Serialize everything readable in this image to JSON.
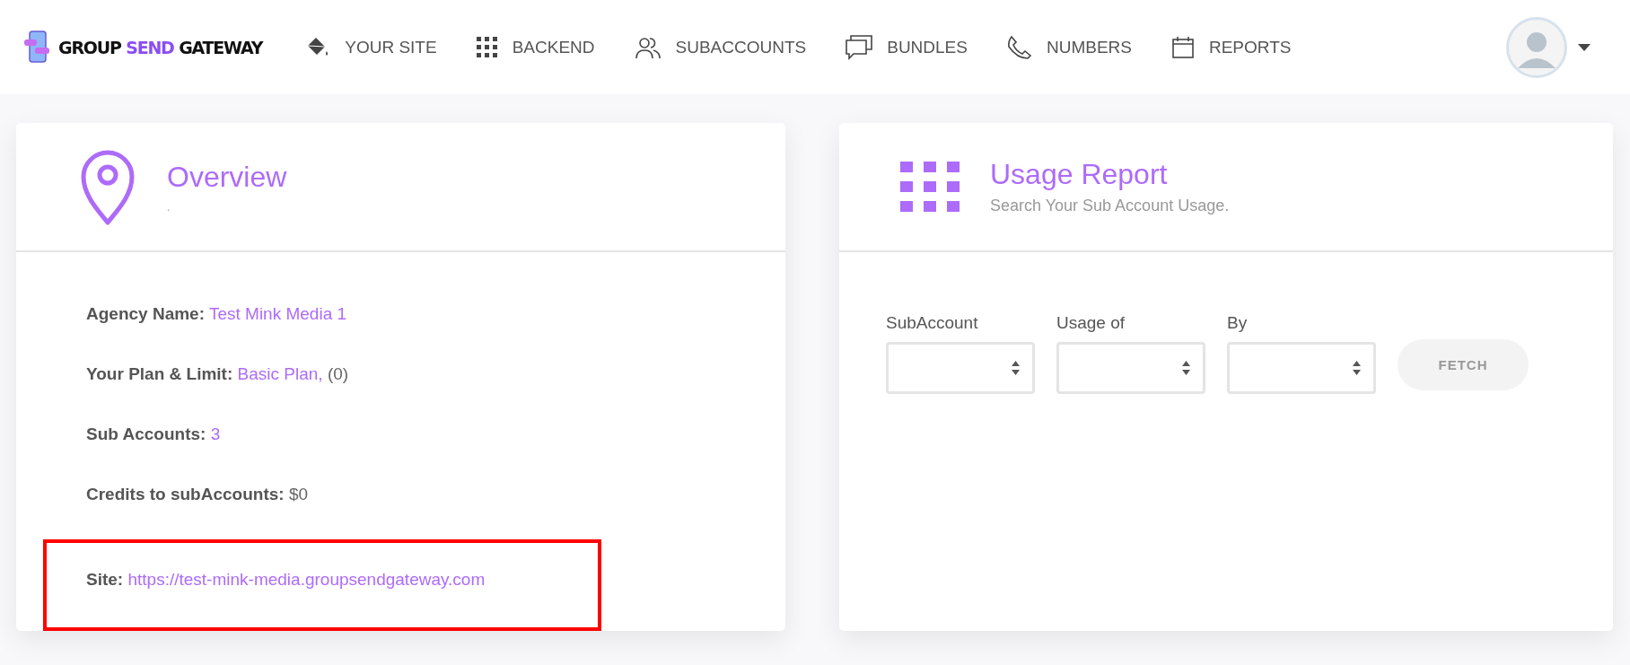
{
  "header": {
    "logo_words": [
      {
        "text": "GROUP",
        "highlight": false
      },
      {
        "text": "SEND",
        "highlight": true
      },
      {
        "text": "GATEWAY",
        "highlight": false
      }
    ],
    "nav": [
      {
        "kind": "paint",
        "label": "YOUR SITE"
      },
      {
        "kind": "grid",
        "label": "BACKEND"
      },
      {
        "kind": "users",
        "label": "SUBACCOUNTS"
      },
      {
        "kind": "chat",
        "label": "BUNDLES"
      },
      {
        "kind": "phone",
        "label": "NUMBERS"
      },
      {
        "kind": "calendar",
        "label": "REPORTS"
      }
    ]
  },
  "overview": {
    "title": "Overview",
    "subtitle": ".",
    "rows": [
      {
        "label": "Agency Name:",
        "value": "Test Mink Media 1",
        "value_accent": true,
        "highlighted": false
      },
      {
        "label": "Your Plan & Limit:",
        "value": "Basic Plan,",
        "value_accent": true,
        "extra": "(0)",
        "highlighted": false
      },
      {
        "label": "Sub Accounts:",
        "value": "3",
        "value_accent": true,
        "highlighted": false
      },
      {
        "label": "Credits to subAccounts:",
        "value": "$0",
        "value_accent": false,
        "highlighted": false
      },
      {
        "label": "Site:",
        "value": "https://test-mink-media.groupsendgateway.com",
        "value_accent": true,
        "highlighted": true
      }
    ]
  },
  "usage_report": {
    "title": "Usage Report",
    "subtitle": "Search Your Sub Account Usage.",
    "fields": [
      {
        "label": "SubAccount"
      },
      {
        "label": "Usage of"
      },
      {
        "label": "By"
      }
    ],
    "button": "FETCH"
  }
}
